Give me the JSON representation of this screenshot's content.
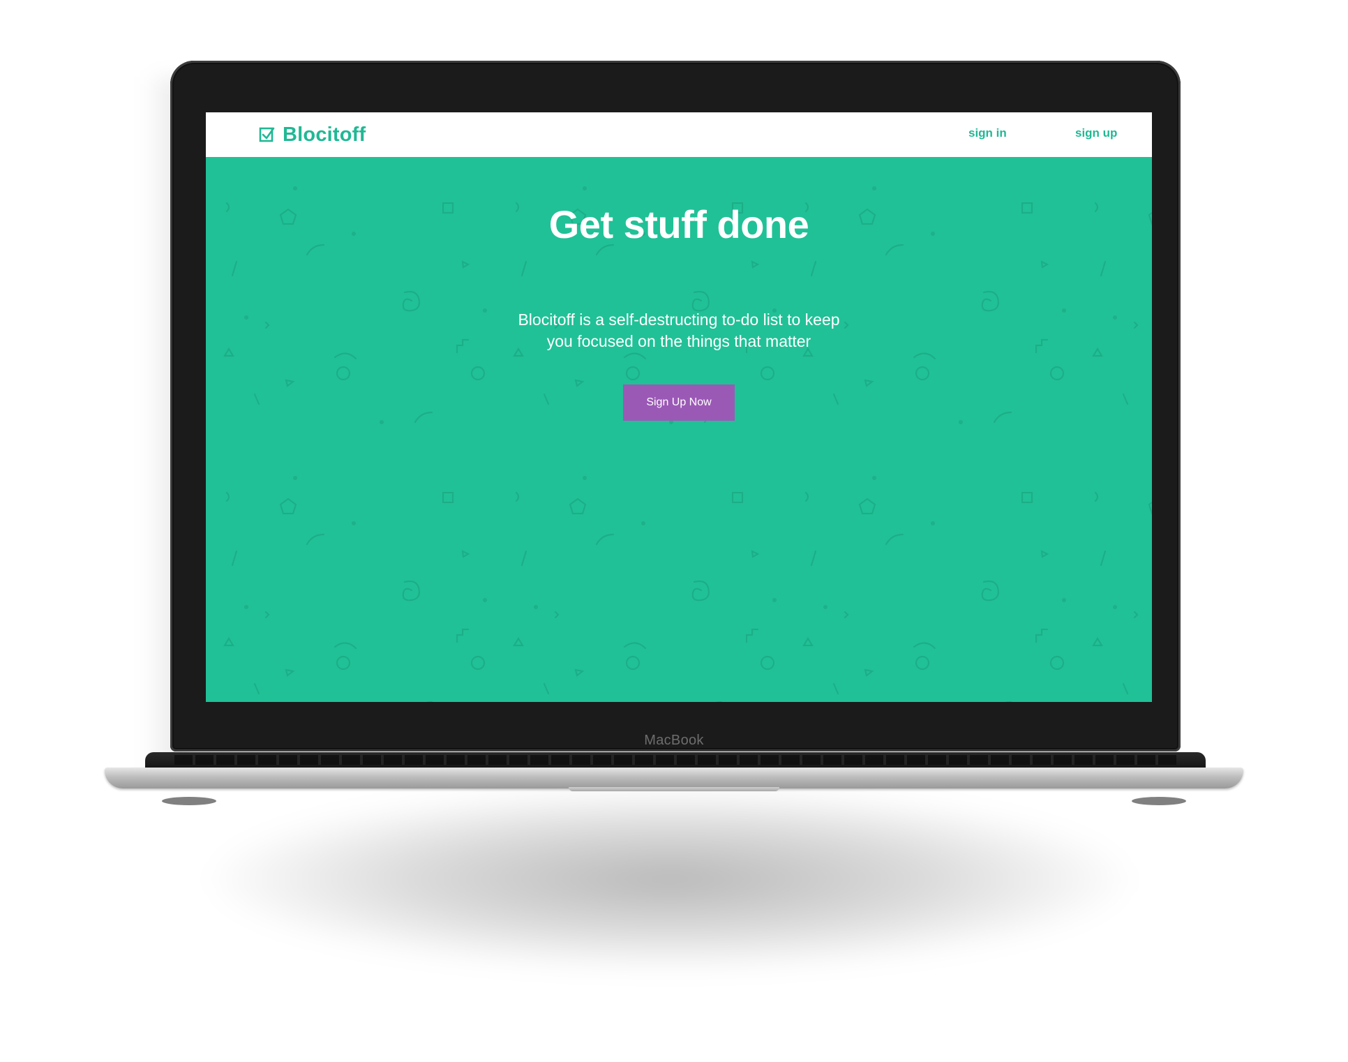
{
  "device": {
    "label": "MacBook"
  },
  "navbar": {
    "brand": "Blocitoff",
    "brand_icon": "checkbox-icon",
    "links": [
      {
        "label": "sign in"
      },
      {
        "label": "sign up"
      }
    ]
  },
  "hero": {
    "title": "Get stuff done",
    "subtitle_line1": "Blocitoff is a self-destructing to-do list to keep",
    "subtitle_line2": "you focused on the things that matter",
    "cta_label": "Sign Up Now"
  },
  "colors": {
    "hero_background": "#20c196",
    "brand_text": "#20b894",
    "cta_background": "#9b59b6",
    "navbar_background": "#ffffff",
    "bezel": "#1b1b1b"
  }
}
